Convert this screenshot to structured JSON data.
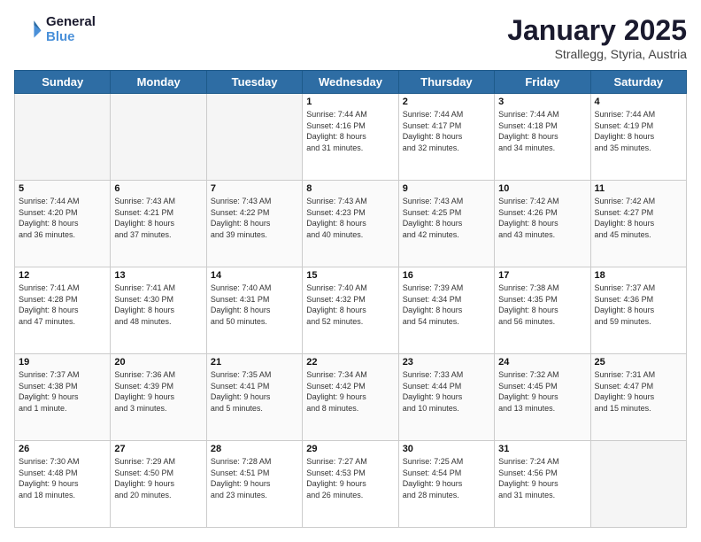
{
  "header": {
    "logo_line1": "General",
    "logo_line2": "Blue",
    "month_title": "January 2025",
    "location": "Strallegg, Styria, Austria"
  },
  "weekdays": [
    "Sunday",
    "Monday",
    "Tuesday",
    "Wednesday",
    "Thursday",
    "Friday",
    "Saturday"
  ],
  "weeks": [
    [
      {
        "day": "",
        "text": ""
      },
      {
        "day": "",
        "text": ""
      },
      {
        "day": "",
        "text": ""
      },
      {
        "day": "1",
        "text": "Sunrise: 7:44 AM\nSunset: 4:16 PM\nDaylight: 8 hours\nand 31 minutes."
      },
      {
        "day": "2",
        "text": "Sunrise: 7:44 AM\nSunset: 4:17 PM\nDaylight: 8 hours\nand 32 minutes."
      },
      {
        "day": "3",
        "text": "Sunrise: 7:44 AM\nSunset: 4:18 PM\nDaylight: 8 hours\nand 34 minutes."
      },
      {
        "day": "4",
        "text": "Sunrise: 7:44 AM\nSunset: 4:19 PM\nDaylight: 8 hours\nand 35 minutes."
      }
    ],
    [
      {
        "day": "5",
        "text": "Sunrise: 7:44 AM\nSunset: 4:20 PM\nDaylight: 8 hours\nand 36 minutes."
      },
      {
        "day": "6",
        "text": "Sunrise: 7:43 AM\nSunset: 4:21 PM\nDaylight: 8 hours\nand 37 minutes."
      },
      {
        "day": "7",
        "text": "Sunrise: 7:43 AM\nSunset: 4:22 PM\nDaylight: 8 hours\nand 39 minutes."
      },
      {
        "day": "8",
        "text": "Sunrise: 7:43 AM\nSunset: 4:23 PM\nDaylight: 8 hours\nand 40 minutes."
      },
      {
        "day": "9",
        "text": "Sunrise: 7:43 AM\nSunset: 4:25 PM\nDaylight: 8 hours\nand 42 minutes."
      },
      {
        "day": "10",
        "text": "Sunrise: 7:42 AM\nSunset: 4:26 PM\nDaylight: 8 hours\nand 43 minutes."
      },
      {
        "day": "11",
        "text": "Sunrise: 7:42 AM\nSunset: 4:27 PM\nDaylight: 8 hours\nand 45 minutes."
      }
    ],
    [
      {
        "day": "12",
        "text": "Sunrise: 7:41 AM\nSunset: 4:28 PM\nDaylight: 8 hours\nand 47 minutes."
      },
      {
        "day": "13",
        "text": "Sunrise: 7:41 AM\nSunset: 4:30 PM\nDaylight: 8 hours\nand 48 minutes."
      },
      {
        "day": "14",
        "text": "Sunrise: 7:40 AM\nSunset: 4:31 PM\nDaylight: 8 hours\nand 50 minutes."
      },
      {
        "day": "15",
        "text": "Sunrise: 7:40 AM\nSunset: 4:32 PM\nDaylight: 8 hours\nand 52 minutes."
      },
      {
        "day": "16",
        "text": "Sunrise: 7:39 AM\nSunset: 4:34 PM\nDaylight: 8 hours\nand 54 minutes."
      },
      {
        "day": "17",
        "text": "Sunrise: 7:38 AM\nSunset: 4:35 PM\nDaylight: 8 hours\nand 56 minutes."
      },
      {
        "day": "18",
        "text": "Sunrise: 7:37 AM\nSunset: 4:36 PM\nDaylight: 8 hours\nand 59 minutes."
      }
    ],
    [
      {
        "day": "19",
        "text": "Sunrise: 7:37 AM\nSunset: 4:38 PM\nDaylight: 9 hours\nand 1 minute."
      },
      {
        "day": "20",
        "text": "Sunrise: 7:36 AM\nSunset: 4:39 PM\nDaylight: 9 hours\nand 3 minutes."
      },
      {
        "day": "21",
        "text": "Sunrise: 7:35 AM\nSunset: 4:41 PM\nDaylight: 9 hours\nand 5 minutes."
      },
      {
        "day": "22",
        "text": "Sunrise: 7:34 AM\nSunset: 4:42 PM\nDaylight: 9 hours\nand 8 minutes."
      },
      {
        "day": "23",
        "text": "Sunrise: 7:33 AM\nSunset: 4:44 PM\nDaylight: 9 hours\nand 10 minutes."
      },
      {
        "day": "24",
        "text": "Sunrise: 7:32 AM\nSunset: 4:45 PM\nDaylight: 9 hours\nand 13 minutes."
      },
      {
        "day": "25",
        "text": "Sunrise: 7:31 AM\nSunset: 4:47 PM\nDaylight: 9 hours\nand 15 minutes."
      }
    ],
    [
      {
        "day": "26",
        "text": "Sunrise: 7:30 AM\nSunset: 4:48 PM\nDaylight: 9 hours\nand 18 minutes."
      },
      {
        "day": "27",
        "text": "Sunrise: 7:29 AM\nSunset: 4:50 PM\nDaylight: 9 hours\nand 20 minutes."
      },
      {
        "day": "28",
        "text": "Sunrise: 7:28 AM\nSunset: 4:51 PM\nDaylight: 9 hours\nand 23 minutes."
      },
      {
        "day": "29",
        "text": "Sunrise: 7:27 AM\nSunset: 4:53 PM\nDaylight: 9 hours\nand 26 minutes."
      },
      {
        "day": "30",
        "text": "Sunrise: 7:25 AM\nSunset: 4:54 PM\nDaylight: 9 hours\nand 28 minutes."
      },
      {
        "day": "31",
        "text": "Sunrise: 7:24 AM\nSunset: 4:56 PM\nDaylight: 9 hours\nand 31 minutes."
      },
      {
        "day": "",
        "text": ""
      }
    ]
  ]
}
